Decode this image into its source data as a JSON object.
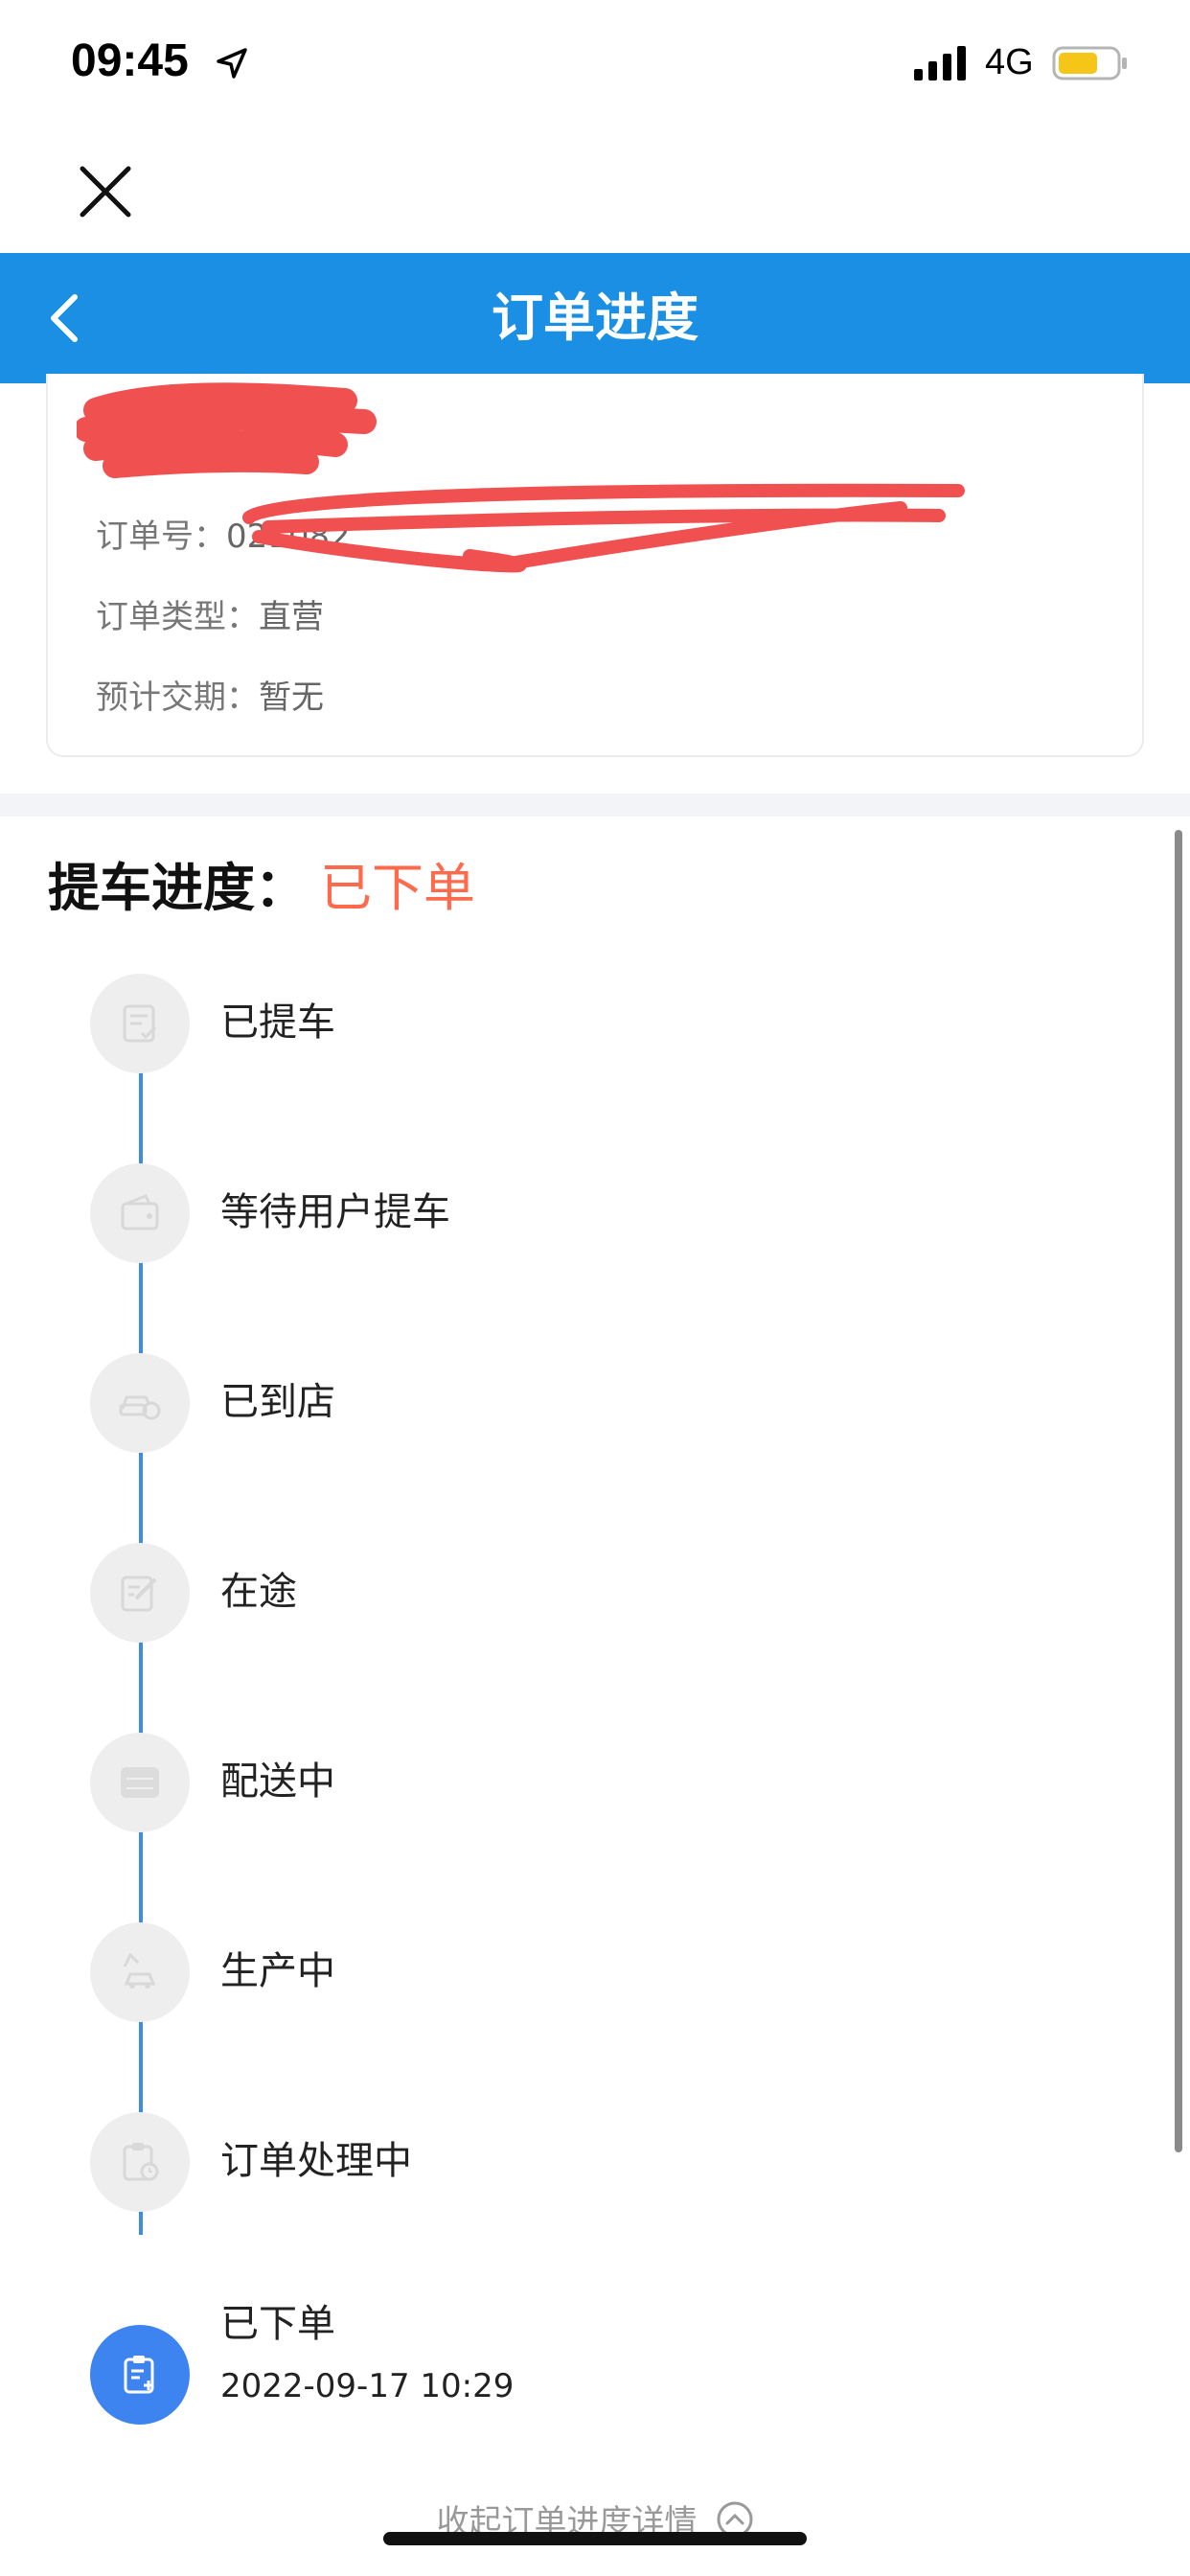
{
  "status_bar": {
    "time": "09:45",
    "network": "4G",
    "battery_color": "#f5c518"
  },
  "nav": {
    "title": "订单进度"
  },
  "order_info": {
    "order_no_label": "订单号：",
    "order_no_value": "021082",
    "type_label": "订单类型：",
    "type_value": "直营",
    "delivery_label": "预计交期：",
    "delivery_value": "暂无",
    "redaction_color": "#f0504f"
  },
  "progress": {
    "heading": "提车进度：",
    "current_status": "已下单",
    "status_color": "#ff6a4d",
    "line_color": "#3b8ee0",
    "steps": [
      {
        "label": "已提车",
        "icon": "document-check-icon",
        "active": false
      },
      {
        "label": "等待用户提车",
        "icon": "wallet-icon",
        "active": false
      },
      {
        "label": "已到店",
        "icon": "car-store-icon",
        "active": false
      },
      {
        "label": "在途",
        "icon": "edit-note-icon",
        "active": false
      },
      {
        "label": "配送中",
        "icon": "erp-icon",
        "active": false
      },
      {
        "label": "生产中",
        "icon": "robot-arm-car-icon",
        "active": false
      },
      {
        "label": "订单处理中",
        "icon": "clipboard-clock-icon",
        "active": false
      },
      {
        "label": "已下单",
        "icon": "clipboard-plus-icon",
        "active": true,
        "time": "2022-09-17 10:29"
      }
    ],
    "collapse_label": "收起订单进度详情"
  }
}
